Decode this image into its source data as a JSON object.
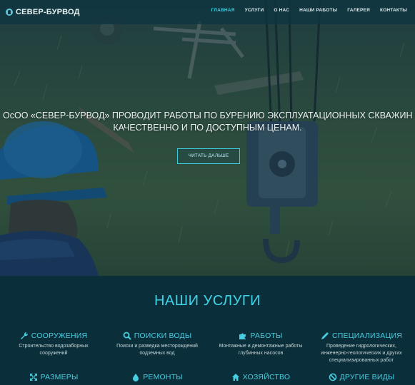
{
  "navbar": {
    "brand": "СЕВЕР-БУРВОД",
    "items": [
      {
        "label": "ГЛАВНАЯ",
        "active": true
      },
      {
        "label": "УСЛУГИ",
        "active": false
      },
      {
        "label": "О НАС",
        "active": false
      },
      {
        "label": "НАШИ РАБОТЫ",
        "active": false
      },
      {
        "label": "ГАЛЕРЕЯ",
        "active": false
      },
      {
        "label": "КОНТАКТЫ",
        "active": false
      }
    ]
  },
  "hero": {
    "line1": "ОсОО «СЕВЕР-БУРВОД» ПРОВОДИТ РАБОТЫ ПО БУРЕНИЮ ЭКСПЛУАТАЦИОННЫХ СКВАЖИН НА ВОДУ",
    "line2": "КАЧЕСТВЕННО И ПО ДОСТУПНЫМ ЦЕНАМ.",
    "button": "ЧИТАТЬ ДАЛЬШЕ"
  },
  "services": {
    "title": "НАШИ УСЛУГИ",
    "items": [
      {
        "icon": "wrench-icon",
        "title": "СООРУЖЕНИЯ",
        "desc": "Строительство водозаборных сооружений"
      },
      {
        "icon": "search-icon",
        "title": "ПОИСКИ ВОДЫ",
        "desc": "Поиски и разведка месторождений подземных вод"
      },
      {
        "icon": "puzzle-icon",
        "title": "РАБОТЫ",
        "desc": "Монтажные и демонтажные работы глубинных насосов"
      },
      {
        "icon": "pencil-icon",
        "title": "СПЕЦИАЛИЗАЦИЯ",
        "desc": "Проведение гидрологических, инженерно-геологических и других специализированных работ"
      },
      {
        "icon": "arrows-expand-icon",
        "title": "РАЗМЕРЫ",
        "desc": ""
      },
      {
        "icon": "water-drop-icon",
        "title": "РЕМОНТЫ",
        "desc": ""
      },
      {
        "icon": "home-icon",
        "title": "ХОЗЯЙСТВО",
        "desc": ""
      },
      {
        "icon": "ban-icon",
        "title": "ДРУГИЕ ВИДЫ",
        "desc": ""
      }
    ]
  },
  "colors": {
    "accent": "#3fd3e6",
    "navbar_bg": "#0e3440",
    "section_bg": "#0b2f3a"
  }
}
